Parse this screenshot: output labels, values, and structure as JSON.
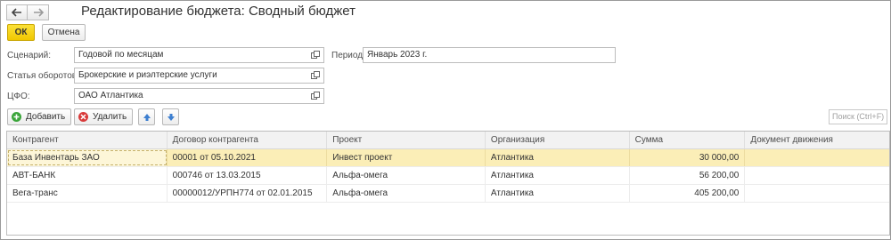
{
  "window": {
    "title": "Редактирование бюджета: Сводный бюджет"
  },
  "commands": {
    "ok_label": "ОК",
    "cancel_label": "Отмена"
  },
  "form": {
    "scenario": {
      "label": "Сценарий:",
      "value": "Годовой по месяцам"
    },
    "period": {
      "label": "Период:",
      "value": "Январь 2023 г."
    },
    "turnover_item": {
      "label": "Статья оборотов:",
      "value": "Брокерские и риэлтерские услуги"
    },
    "cfo": {
      "label": "ЦФО:",
      "value": "ОАО Атлантика"
    }
  },
  "table_toolbar": {
    "add_label": "Добавить",
    "delete_label": "Удалить",
    "search_placeholder": "Поиск (Ctrl+F)"
  },
  "table": {
    "columns": [
      "Контрагент",
      "Договор контрагента",
      "Проект",
      "Организация",
      "Сумма",
      "Документ движения"
    ],
    "rows": [
      [
        "База Инвентарь ЗАО",
        "00001 от 05.10.2021",
        "Инвест проект",
        "Атлантика",
        "30 000,00",
        ""
      ],
      [
        "АВТ-БАНК",
        "000746 от 13.03.2015",
        "Альфа-омега",
        "Атлантика",
        "56 200,00",
        ""
      ],
      [
        "Вега-транс",
        "00000012/УРПН774 от 02.01.2015",
        "Альфа-омега",
        "Атлантика",
        "405 200,00",
        ""
      ]
    ],
    "selected_row": 0
  },
  "colors": {
    "ok_button": "#f5d417",
    "selected_row": "#fbeeb7",
    "add_icon": "#3aa53a",
    "delete_icon": "#d83a3a",
    "arrow_icon": "#3d7fd0"
  }
}
